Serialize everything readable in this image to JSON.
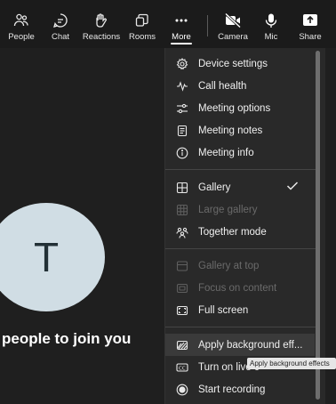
{
  "toolbar": {
    "people": "People",
    "chat": "Chat",
    "reactions": "Reactions",
    "rooms": "Rooms",
    "more": "More",
    "camera": "Camera",
    "mic": "Mic",
    "share": "Share"
  },
  "stage": {
    "avatar_initial": "T",
    "invite_text": "people to join you"
  },
  "menu": {
    "items": [
      {
        "label": "Device settings",
        "icon": "gear-icon",
        "disabled": false
      },
      {
        "label": "Call health",
        "icon": "pulse-icon",
        "disabled": false
      },
      {
        "label": "Meeting options",
        "icon": "sliders-icon",
        "disabled": false
      },
      {
        "label": "Meeting notes",
        "icon": "notes-icon",
        "disabled": false
      },
      {
        "label": "Meeting info",
        "icon": "info-icon",
        "disabled": false
      },
      {
        "label": "Gallery",
        "icon": "grid-icon",
        "disabled": false,
        "checked": true
      },
      {
        "label": "Large gallery",
        "icon": "large-grid-icon",
        "disabled": true
      },
      {
        "label": "Together mode",
        "icon": "together-icon",
        "disabled": false
      },
      {
        "label": "Gallery at top",
        "icon": "gallery-top-icon",
        "disabled": true
      },
      {
        "label": "Focus on content",
        "icon": "focus-icon",
        "disabled": true
      },
      {
        "label": "Full screen",
        "icon": "fullscreen-icon",
        "disabled": false
      },
      {
        "label": "Apply background eff...",
        "icon": "background-effects-icon",
        "disabled": false
      },
      {
        "label": "Turn on live c",
        "icon": "captions-icon",
        "disabled": false
      },
      {
        "label": "Start recording",
        "icon": "record-icon",
        "disabled": false
      }
    ]
  },
  "tooltip": "Apply background effects"
}
